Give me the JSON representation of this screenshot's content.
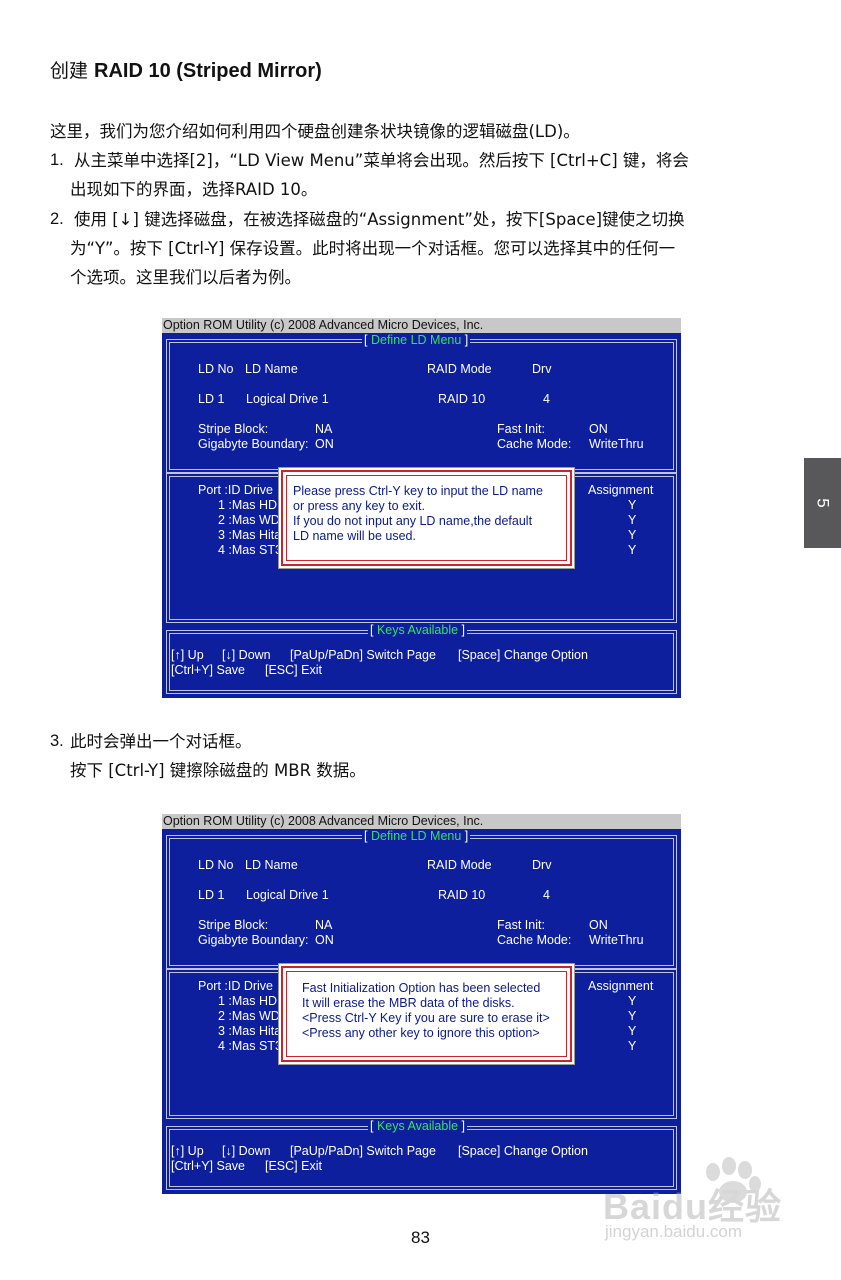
{
  "header": {
    "title_cn": "创建",
    "title_bold": "RAID 10 (Striped Mirror)"
  },
  "intro": "这里，我们为您介绍如何利用四个硬盘创建条状块镜像的逻辑磁盘(LD)。",
  "steps": [
    {
      "num": "1.",
      "line1": "从主菜单中选择[2]，“LD View Menu”菜单将会出现。然后按下 [Ctrl+C] 键，将会",
      "line2": "出现如下的界面，选择RAID 10。"
    },
    {
      "num": "2.",
      "line1": "使用 [↓] 键选择磁盘，在被选择磁盘的“Assignment”处，按下[Space]键使之切换",
      "line2": "为“Y”。按下 [Ctrl-Y] 保存设置。此时将出现一个对话框。您可以选择其中的任何一",
      "line3": "个选项。这里我们以后者为例。"
    },
    {
      "num": "3.",
      "line1": "此时会弹出一个对话框。",
      "line2": "按下 [Ctrl-Y] 键擦除磁盘的 MBR 数据。"
    }
  ],
  "chapter_tab": "5",
  "page_number": "83",
  "watermark": {
    "brand": "Baidu经验",
    "url": "jingyan.baidu.com"
  },
  "bios_common": {
    "topbar": "Option ROM Utility (c) 2008 Advanced Micro Devices, Inc.",
    "define_title": "Define LD Menu",
    "hdr_ldno": "LD No",
    "hdr_ldname": "LD Name",
    "hdr_raid": "RAID Mode",
    "hdr_drv": "Drv",
    "ld_no": "LD  1",
    "ld_name": "Logical Drive 1",
    "raid_mode": "RAID 10",
    "drv_count": "4",
    "stripe_label": "Stripe Block:",
    "stripe_value": "NA",
    "gb_label": "Gigabyte Boundary:",
    "gb_value": "ON",
    "fast_label": "Fast Init:",
    "fast_value": "ON",
    "cache_label": "Cache Mode:",
    "cache_value": "WriteThru",
    "port_hdr": "Port  :ID   Drive",
    "assign_hdr": "Assignment",
    "drives": [
      "1 :Mas HD",
      "2 :Mas WD",
      "3 :Mas Hita",
      "4 :Mas ST3"
    ],
    "assign_values": [
      "Y",
      "Y",
      "Y",
      "Y"
    ],
    "keys_title": "Keys Available",
    "key_up": "[↑] Up",
    "key_down": "[↓] Down",
    "key_page": "[PaUp/PaDn] Switch Page",
    "key_space": "[Space] Change Option",
    "key_save": "[Ctrl+Y] Save",
    "key_exit": "[ESC] Exit"
  },
  "dialog1": [
    "Please press Ctrl-Y key to input the LD name",
    "or press any key to exit.",
    "If you do not input any LD name,the default",
    "LD name will be used."
  ],
  "dialog2": [
    "Fast Initialization Option has been selected",
    "It will erase the MBR data of the disks.",
    "<Press Ctrl-Y Key if you are sure to erase it>",
    "<Press any other key to ignore this option>"
  ],
  "colors": {
    "bios_bg": "#0d1f9c",
    "section_title": "#38e060",
    "dialog_border": "#c8262c",
    "dialog_text": "#0a1a8c",
    "tab_bg": "#58585b"
  }
}
